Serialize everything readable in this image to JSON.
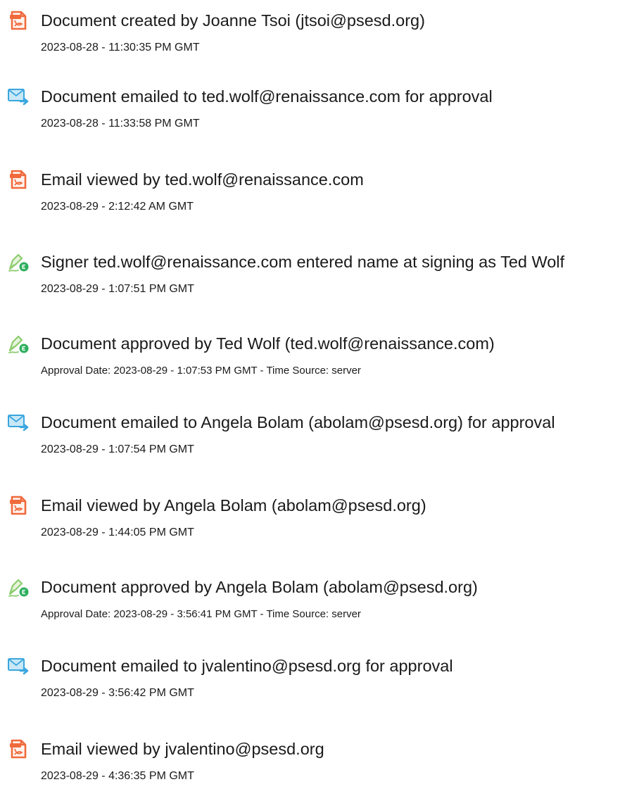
{
  "events": [
    {
      "icon": "document-created-icon",
      "title": "Document created by Joanne Tsoi (jtsoi@psesd.org)",
      "detail": "2023-08-28 - 11:30:35 PM GMT"
    },
    {
      "icon": "email-sent-icon",
      "title": "Document emailed to ted.wolf@renaissance.com for approval",
      "detail": "2023-08-28 - 11:33:58 PM GMT"
    },
    {
      "icon": "document-viewed-icon",
      "title": "Email viewed by ted.wolf@renaissance.com",
      "detail": "2023-08-29 - 2:12:42 AM GMT"
    },
    {
      "icon": "signature-pen-icon",
      "title": "Signer ted.wolf@renaissance.com entered name at signing as Ted Wolf",
      "detail": "2023-08-29 - 1:07:51 PM GMT"
    },
    {
      "icon": "signature-pen-icon",
      "title": "Document approved by Ted Wolf (ted.wolf@renaissance.com)",
      "detail": "Approval Date: 2023-08-29 - 1:07:53 PM GMT - Time Source: server"
    },
    {
      "icon": "email-sent-icon",
      "title": "Document emailed to Angela Bolam (abolam@psesd.org) for approval",
      "detail": "2023-08-29 - 1:07:54 PM GMT"
    },
    {
      "icon": "document-viewed-icon",
      "title": "Email viewed by Angela Bolam (abolam@psesd.org)",
      "detail": "2023-08-29 - 1:44:05 PM GMT"
    },
    {
      "icon": "signature-pen-icon",
      "title": "Document approved by Angela Bolam (abolam@psesd.org)",
      "detail": "Approval Date: 2023-08-29 - 3:56:41 PM GMT - Time Source: server"
    },
    {
      "icon": "email-sent-icon",
      "title": "Document emailed to jvalentino@psesd.org for approval",
      "detail": "2023-08-29 - 3:56:42 PM GMT"
    },
    {
      "icon": "document-viewed-icon",
      "title": "Email viewed by jvalentino@psesd.org",
      "detail": "2023-08-29 - 4:36:35 PM GMT"
    }
  ],
  "colors": {
    "document_icon": "#f06a3c",
    "email_icon_fill": "#c9e8f7",
    "email_icon_stroke": "#39a6de",
    "pen_icon": "#8ccc6e",
    "pen_badge": "#2eaf5e",
    "text": "#1a1a1a"
  }
}
